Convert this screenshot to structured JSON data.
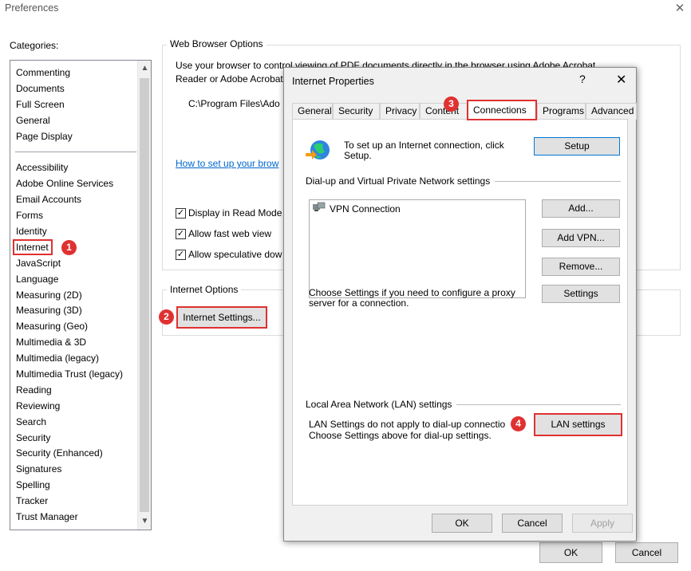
{
  "window": {
    "title": "Preferences",
    "close_glyph": "✕"
  },
  "categories": {
    "label": "Categories:",
    "group1": [
      "Commenting",
      "Documents",
      "Full Screen",
      "General",
      "Page Display"
    ],
    "group2": [
      "Accessibility",
      "Adobe Online Services",
      "Email Accounts",
      "Forms",
      "Identity",
      "Internet",
      "JavaScript",
      "Language",
      "Measuring (2D)",
      "Measuring (3D)",
      "Measuring (Geo)",
      "Multimedia & 3D",
      "Multimedia (legacy)",
      "Multimedia Trust (legacy)",
      "Reading",
      "Reviewing",
      "Search",
      "Security",
      "Security (Enhanced)",
      "Signatures",
      "Spelling",
      "Tracker",
      "Trust Manager"
    ],
    "selected": "Internet"
  },
  "web_browser_options": {
    "title": "Web Browser Options",
    "desc_line1": "Use your browser to control viewing of PDF documents directly in the browser using Adobe Acrobat",
    "desc_line2": "Reader or Adobe Acrobat",
    "path": "C:\\Program Files\\Ado",
    "link": "How to set up your brow",
    "checkboxes": [
      "Display in Read Mode",
      "Allow fast web view",
      "Allow speculative dow"
    ]
  },
  "internet_options": {
    "title": "Internet Options",
    "button": "Internet Settings..."
  },
  "footer": {
    "ok": "OK",
    "cancel": "Cancel"
  },
  "badges": [
    "1",
    "2",
    "3",
    "4"
  ],
  "dialog": {
    "title": "Internet Properties",
    "help": "?",
    "close": "✕",
    "tabs": [
      "General",
      "Security",
      "Privacy",
      "Content",
      "Connections",
      "Programs",
      "Advanced"
    ],
    "active_tab": "Connections",
    "setup_text_line1": "To set up an Internet connection, click",
    "setup_text_line2": "Setup.",
    "setup_button": "Setup",
    "dialup_heading": "Dial-up and Virtual Private Network settings",
    "vpn_items": [
      "VPN Connection"
    ],
    "add_button": "Add...",
    "add_vpn_button": "Add VPN...",
    "remove_button": "Remove...",
    "proxy_text_line1": "Choose Settings if you need to configure a proxy",
    "proxy_text_line2": "server for a connection.",
    "settings_button": "Settings",
    "lan_heading": "Local Area Network (LAN) settings",
    "lan_text_line1": "LAN Settings do not apply to dial-up connectio",
    "lan_text_line2": "Choose Settings above for dial-up settings.",
    "lan_button": "LAN settings",
    "ok": "OK",
    "cancel": "Cancel",
    "apply": "Apply"
  },
  "icons": [
    "globe-icon",
    "vpn-connection-icon",
    "chevron-up-icon",
    "chevron-down-icon",
    "checkmark-icon"
  ],
  "colors": {
    "highlight": "#e03131",
    "link": "#0066cc",
    "default_button_border": "#0078d7",
    "dialog_bg": "#f0f0f0"
  }
}
